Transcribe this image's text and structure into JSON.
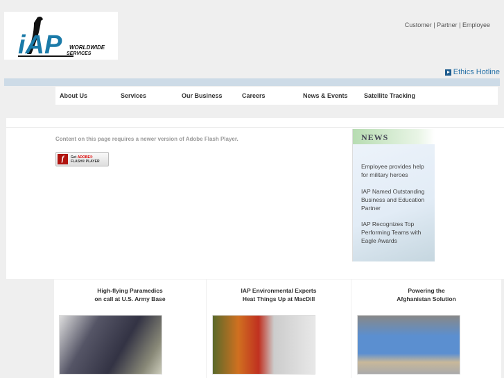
{
  "logo": {
    "text": "IAP",
    "subtitle": "WORLDWIDE SERVICES"
  },
  "toplinks": [
    "Customer",
    "Partner",
    "Employee"
  ],
  "ethics": "Ethics Hotline",
  "nav": [
    "About Us",
    "Services",
    "Our Business",
    "Careers",
    "News & Events",
    "Satellite Tracking"
  ],
  "flash": {
    "message": "Content on this page requires a newer version of Adobe Flash Player.",
    "button_line1": "Get",
    "button_brand": "ADOBE®",
    "button_line2": "FLASH® PLAYER"
  },
  "news": {
    "heading": "NEWS",
    "items": [
      "Employee provides help for military heroes",
      "IAP Named Outstanding Business and Education Partner",
      "IAP Recognizes Top Performing Teams with Eagle Awards"
    ]
  },
  "features": [
    {
      "line1": "High-flying Paramedics",
      "line2": "on call at U.S. Army Base"
    },
    {
      "line1": "IAP Environmental Experts",
      "line2": "Heat Things Up at MacDill"
    },
    {
      "line1": "Powering the",
      "line2": "Afghanistan Solution"
    }
  ],
  "colors": {
    "accent": "#2a73a8",
    "bar": "#cddbe7"
  }
}
